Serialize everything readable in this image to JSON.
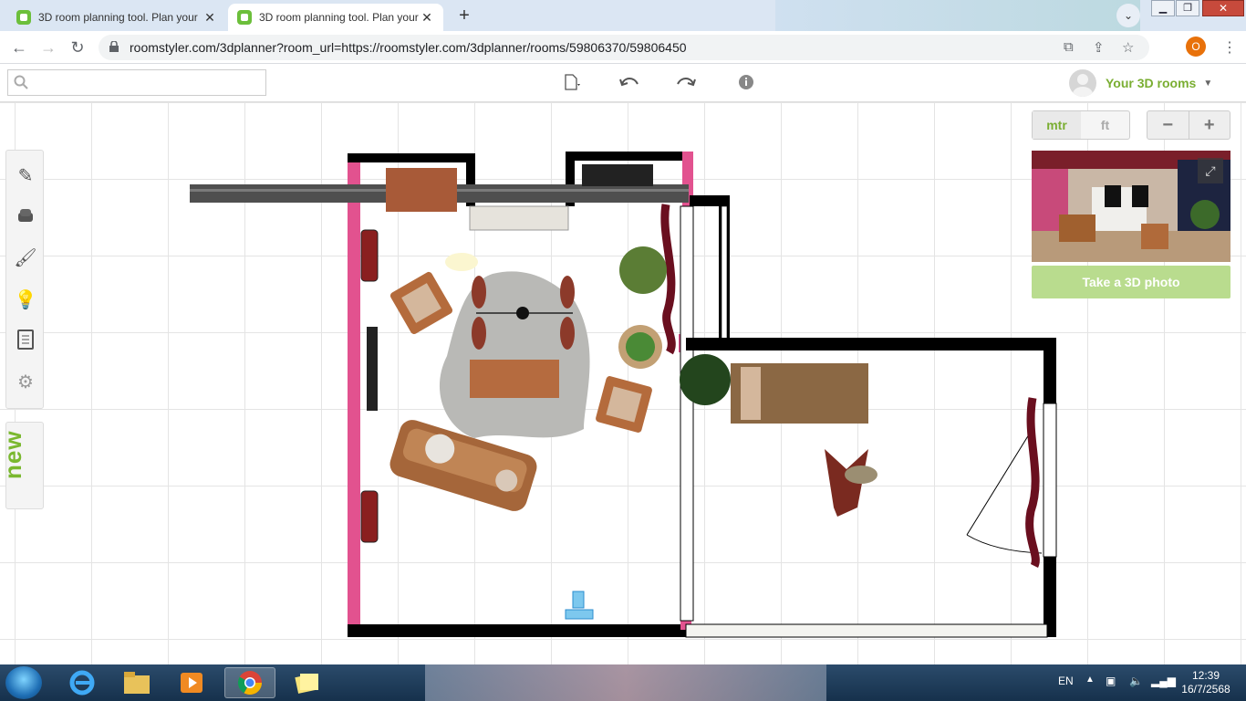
{
  "browser": {
    "tabs": [
      {
        "title": "3D room planning tool. Plan your",
        "active": false
      },
      {
        "title": "3D room planning tool. Plan your",
        "active": true
      }
    ],
    "new_tab_label": "+",
    "tab_search_icon": "chevron-down-icon",
    "url": "roomstyler.com/3dplanner?room_url=https://roomstyler.com/3dplanner/rooms/59806370/59806450",
    "profile_initial": "O",
    "window_controls": {
      "minimize": "▁",
      "restore": "❐",
      "close": "✕"
    }
  },
  "app_toolbar": {
    "search_placeholder": "",
    "user_name": "Your 3D rooms",
    "user_caret": "▼",
    "icons": [
      "new-file-icon",
      "undo-icon",
      "redo-icon",
      "info-icon"
    ]
  },
  "left_tools": {
    "icons": [
      "build-tool-icon",
      "furniture-icon",
      "paint-brush-icon",
      "light-bulb-icon",
      "clipboard-icon",
      "settings-gear-icon"
    ],
    "new_label": "new"
  },
  "units": {
    "active": "mtr",
    "inactive": "ft"
  },
  "zoom": {
    "out": "−",
    "in": "+"
  },
  "photo_button": "Take a 3D photo",
  "colors": {
    "accent_green": "#7aae32",
    "wall_pink": "#e2528f",
    "wall_black": "#000000",
    "photo_button": "#b9dc8e"
  },
  "taskbar": {
    "language": "EN",
    "time": "12:39",
    "date": "16/7/2568",
    "apps": [
      "internet-explorer-icon",
      "file-explorer-icon",
      "media-player-icon",
      "chrome-icon",
      "sticky-notes-icon"
    ]
  }
}
